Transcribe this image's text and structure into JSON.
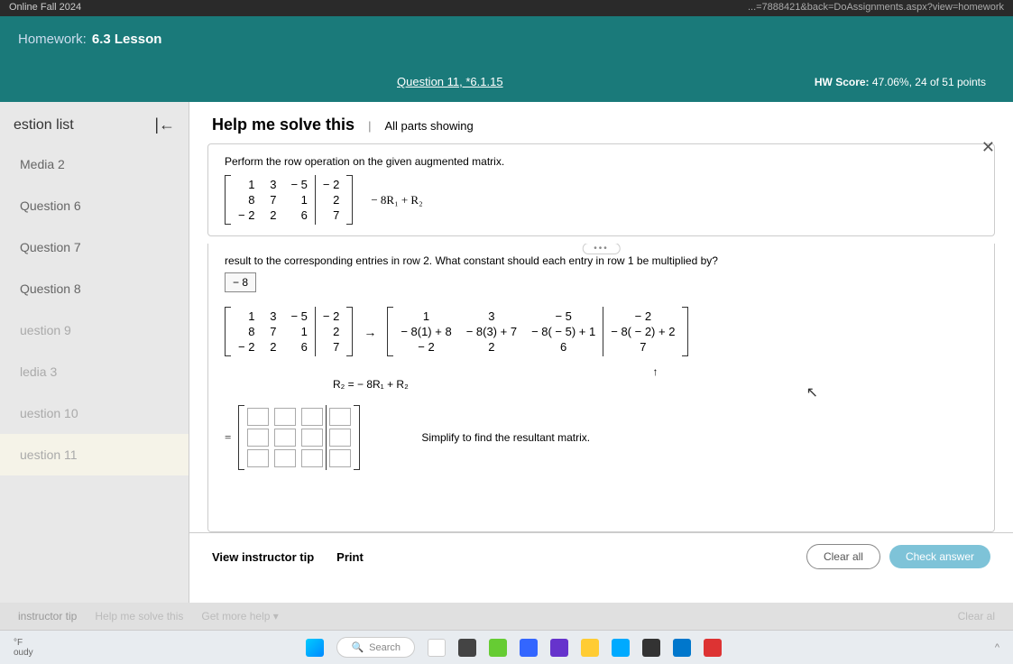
{
  "top": {
    "course": "Online Fall 2024",
    "url": "...=7888421&back=DoAssignments.aspx?view=homework"
  },
  "header": {
    "hw_label": "Homework:",
    "hw_title": "6.3 Lesson",
    "question_nav": "Question 11, *6.1.15",
    "score_label": "HW Score:",
    "score_value": "47.06%, 24 of 51 points"
  },
  "sidebar": {
    "title": "estion list",
    "items": [
      {
        "label": "Media 2"
      },
      {
        "label": "Question 6"
      },
      {
        "label": "Question 7"
      },
      {
        "label": "Question 8"
      },
      {
        "label": "uestion 9"
      },
      {
        "label": "ledia 3"
      },
      {
        "label": "uestion 10"
      },
      {
        "label": "uestion 11"
      }
    ]
  },
  "help": {
    "title": "Help me solve this",
    "sep": "|",
    "parts": "All parts showing",
    "close": "✕"
  },
  "problem": {
    "instruction": "Perform the row operation on the given augmented matrix.",
    "matrix": {
      "r1": [
        "1",
        "3",
        "− 5",
        "− 2"
      ],
      "r2": [
        "8",
        "7",
        "1",
        "2"
      ],
      "r3": [
        "− 2",
        "2",
        "6",
        "7"
      ]
    },
    "operation": "− 8R₁ + R₂"
  },
  "solution": {
    "text1": "result to the corresponding entries in row 2.  What constant should each entry in row 1 be multiplied by?",
    "answer1": "− 8",
    "matrix_left": {
      "r1": [
        "1",
        "3",
        "− 5",
        "− 2"
      ],
      "r2": [
        "8",
        "7",
        "1",
        "2"
      ],
      "r3": [
        "− 2",
        "2",
        "6",
        "7"
      ]
    },
    "arrow": "→",
    "matrix_right": {
      "r1": [
        "1",
        "3",
        "− 5",
        "− 2"
      ],
      "r2": [
        "− 8(1) + 8",
        "− 8(3) + 7",
        "− 8( − 5) + 1",
        "− 8( − 2) + 2"
      ],
      "r3": [
        "− 2",
        "2",
        "6",
        "7"
      ]
    },
    "uparrow": "↑",
    "r2_eq": "R₂  =  − 8R₁ + R₂",
    "eq_sign": "=",
    "simplify": "Simplify to find the resultant matrix."
  },
  "footer": {
    "tip": "View instructor tip",
    "print": "Print",
    "clear": "Clear all",
    "check": "Check answer"
  },
  "bottom": {
    "instructor_tip": "instructor tip",
    "help_me": "Help me solve this",
    "more_help": "Get more help ▾",
    "clear_all": "Clear al"
  },
  "taskbar": {
    "weather_temp": "°F",
    "weather_cond": "oudy",
    "search": "Search"
  }
}
